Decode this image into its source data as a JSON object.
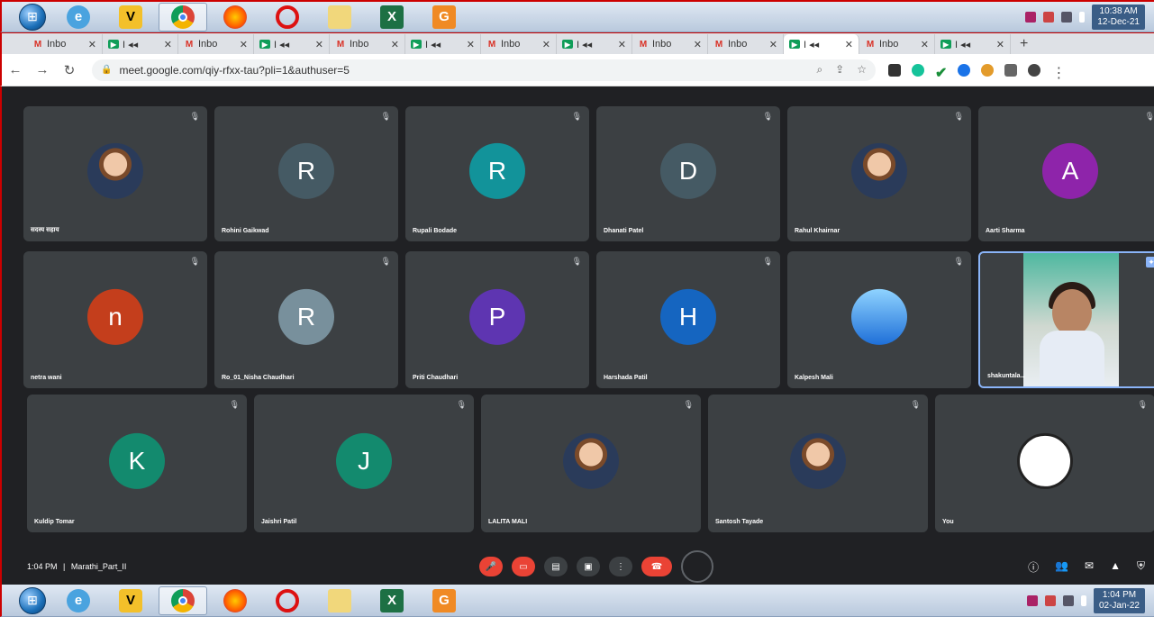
{
  "taskbar_top": {
    "apps": [
      "windows-explorer",
      "internet-explorer",
      "shield-app",
      "chrome",
      "firefox",
      "opera",
      "folder",
      "excel",
      "grammarly-app"
    ],
    "clock_time": "10:38 AM",
    "clock_date": "12-Dec-21"
  },
  "taskbar_bottom": {
    "clock_time": "1:04 PM",
    "clock_date": "02-Jan-22"
  },
  "tabs": [
    {
      "label": "Inbo",
      "type": "gmail"
    },
    {
      "label": "I ◂◂",
      "type": "meet"
    },
    {
      "label": "Inbo",
      "type": "gmail"
    },
    {
      "label": "I ◂◂",
      "type": "meet"
    },
    {
      "label": "Inbo",
      "type": "gmail"
    },
    {
      "label": "I ◂◂",
      "type": "meet"
    },
    {
      "label": "Inbo",
      "type": "gmail"
    },
    {
      "label": "I ◂◂",
      "type": "meet"
    },
    {
      "label": "Inbo",
      "type": "gmail"
    },
    {
      "label": "Inbo",
      "type": "gmail"
    },
    {
      "label": "I ◂◂",
      "type": "meet",
      "active": true
    },
    {
      "label": "Inbo",
      "type": "gmail"
    },
    {
      "label": "I ◂◂",
      "type": "meet"
    }
  ],
  "address": {
    "url": "meet.google.com/qiy-rfxx-tau?pli=1&authuser=5"
  },
  "participants": [
    {
      "name": "सदस्य सहाय",
      "initial": "",
      "color": "#5b7fa8",
      "photo": true
    },
    {
      "name": "Rohini Gaikwad",
      "initial": "R",
      "color": "#455a64"
    },
    {
      "name": "Rupali Bodade",
      "initial": "R",
      "color": "#12939a"
    },
    {
      "name": "Dhanati Patel",
      "initial": "D",
      "color": "#455a64"
    },
    {
      "name": "Rahul Khairnar",
      "initial": "",
      "color": "#3a4a3a",
      "photo": true
    },
    {
      "name": "Aarti Sharma",
      "initial": "A",
      "color": "#8e24aa"
    },
    {
      "name": "netra wani",
      "initial": "n",
      "color": "#c43e1c"
    },
    {
      "name": "Ro_01_Nisha Chaudhari",
      "initial": "R",
      "color": "#78909c"
    },
    {
      "name": "Priti Chaudhari",
      "initial": "P",
      "color": "#5e35b1"
    },
    {
      "name": "Harshada Patil",
      "initial": "H",
      "color": "#1565c0"
    },
    {
      "name": "Kalpesh Mali",
      "initial": "",
      "color": "#1e88e5",
      "photo": true
    },
    {
      "name": "shakuntala...",
      "initial": "",
      "color": "#4fb8a0",
      "speaker": true
    },
    {
      "name": "Kuldip Tomar",
      "initial": "K",
      "color": "#138a6e"
    },
    {
      "name": "Jaishri Patil",
      "initial": "J",
      "color": "#138a6e"
    },
    {
      "name": "LALITA MALI",
      "initial": "",
      "color": "#6a4a3a",
      "photo": true
    },
    {
      "name": "Santosh Tayade",
      "initial": "",
      "color": "#9bbf6a",
      "photo": true
    },
    {
      "name": "You",
      "initial": "",
      "color": "#ffffff",
      "photo": true
    }
  ],
  "meeting": {
    "time": "1:04 PM",
    "separator": "|",
    "title": "Marathi_Part_II"
  }
}
